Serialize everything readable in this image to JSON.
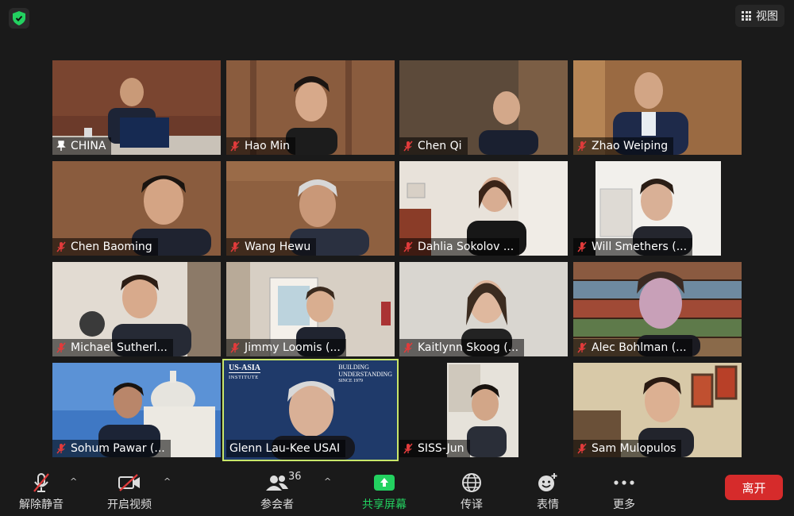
{
  "topbar": {
    "view_label": "视图"
  },
  "participants": [
    {
      "name": "CHINA",
      "muted": false,
      "pinned": true
    },
    {
      "name": "Hao Min",
      "muted": true
    },
    {
      "name": "Chen Qi",
      "muted": true
    },
    {
      "name": "Zhao Weiping",
      "muted": true
    },
    {
      "name": "Chen Baoming",
      "muted": true
    },
    {
      "name": "Wang Hewu",
      "muted": true
    },
    {
      "name": "Dahlia Sokolov ...",
      "muted": true
    },
    {
      "name": "Will Smethers (...",
      "muted": true
    },
    {
      "name": "Michael Sutherl...",
      "muted": true
    },
    {
      "name": "Jimmy Loomis (...",
      "muted": true
    },
    {
      "name": "Kaitlynn Skoog (...",
      "muted": true
    },
    {
      "name": "Alec Bohlman (...",
      "muted": true
    },
    {
      "name": "Sohum Pawar (...",
      "muted": true
    },
    {
      "name": "Glenn Lau-Kee USAI",
      "muted": false,
      "active_speaker": true
    },
    {
      "name": "SISS-Jun",
      "muted": true
    },
    {
      "name": "Sam Mulopulos",
      "muted": true
    }
  ],
  "usai_background": {
    "logo_line1": "US-ASIA",
    "logo_line2": "INSTITUTE",
    "slogan_line1": "BUILDING",
    "slogan_line2": "UNDERSTANDING",
    "slogan_line3": "SINCE 1979"
  },
  "toolbar": {
    "unmute_label": "解除静音",
    "start_video_label": "开启视频",
    "participants_label": "参会者",
    "participants_count": "36",
    "share_label": "共享屏幕",
    "interpret_label": "传译",
    "reactions_label": "表情",
    "more_label": "更多",
    "leave_label": "离开",
    "caret": "^"
  },
  "colors": {
    "share_green": "#23d160",
    "leave_red": "#d62b2b",
    "active_speaker_outline": "#c8e66a"
  }
}
